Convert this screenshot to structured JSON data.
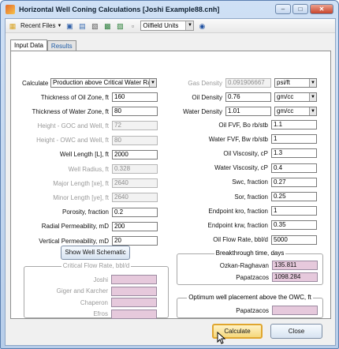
{
  "window": {
    "title": "Horizontal Well Coning Calculations [Joshi Example88.cnh]",
    "btn_min": "–",
    "btn_max": "□",
    "btn_close": "✕"
  },
  "toolbar": {
    "recent_files": "Recent Files",
    "units": "Oilfield Units"
  },
  "tabs": [
    {
      "label": "Input Data"
    },
    {
      "label": "Results"
    }
  ],
  "left": {
    "calculate_label": "Calculate",
    "calculate_value": "Production above Critical Water Ra",
    "fields": [
      {
        "label": "Thickness of Oil Zone, ft",
        "value": "160",
        "disabled": false
      },
      {
        "label": "Thickness of Water Zone, ft",
        "value": "80",
        "disabled": false
      },
      {
        "label": "Height - GOC and Well, ft",
        "value": "72",
        "disabled": true
      },
      {
        "label": "Height - OWC and Well, ft",
        "value": "80",
        "disabled": true
      },
      {
        "label": "Well Length [L], ft",
        "value": "2000",
        "disabled": false
      },
      {
        "label": "Well Radius, ft",
        "value": "0.328",
        "disabled": true
      },
      {
        "label": "Major Length [xe], ft",
        "value": "2640",
        "disabled": true
      },
      {
        "label": "Minor Length [ye], ft",
        "value": "2640",
        "disabled": true
      },
      {
        "label": "Porosity, fraction",
        "value": "0.2",
        "disabled": false
      },
      {
        "label": "Radial Permeability, mD",
        "value": "200",
        "disabled": false
      },
      {
        "label": "Vertical Permeability, mD",
        "value": "20",
        "disabled": false
      }
    ],
    "schematic_button": "Show Well Schematic",
    "critical_title": "Critical Flow Rate, bbl/d",
    "critical": [
      {
        "label": "Joshi"
      },
      {
        "label": "Giger and Karcher"
      },
      {
        "label": "Chaperon"
      },
      {
        "label": "Efros"
      }
    ]
  },
  "right": {
    "density_fields": [
      {
        "label": "Gas Density",
        "value": "0.091906667",
        "unit": "psi/ft",
        "disabled": true
      },
      {
        "label": "Oil Density",
        "value": "0.76",
        "unit": "gm/cc",
        "disabled": false
      },
      {
        "label": "Water Density",
        "value": "1.01",
        "unit": "gm/cc",
        "disabled": false
      }
    ],
    "fields": [
      {
        "label": "Oil FVF, Bo rb/stb",
        "value": "1.1"
      },
      {
        "label": "Water FVF, Bw rb/stb",
        "value": "1"
      },
      {
        "label": "Oil Viscosity, cP",
        "value": "1.3"
      },
      {
        "label": "Water Viscosity, cP",
        "value": "0.4"
      },
      {
        "label": "Swc, fraction",
        "value": "0.27"
      },
      {
        "label": "Sor, fraction",
        "value": "0.25"
      },
      {
        "label": "Endpoint kro, fraction",
        "value": "1"
      },
      {
        "label": "Endpoint krw, fraction",
        "value": "0.35"
      },
      {
        "label": "Oil Flow Rate, bbl/d",
        "value": "5000"
      }
    ],
    "breakthrough_title": "Breakthrough time, days",
    "breakthrough": [
      {
        "label": "Ozkan-Raghavan",
        "value": "135.811"
      },
      {
        "label": "Papatzacos",
        "value": "1098.284"
      }
    ],
    "optimum_title": "Optimum well placement above the OWC, ft",
    "optimum": [
      {
        "label": "Papatzacos",
        "value": ""
      }
    ]
  },
  "buttons": {
    "calculate": "Calculate",
    "close": "Close"
  },
  "colors": {
    "accent": "#e0a62f",
    "result_fill": "#e6c9dc"
  }
}
